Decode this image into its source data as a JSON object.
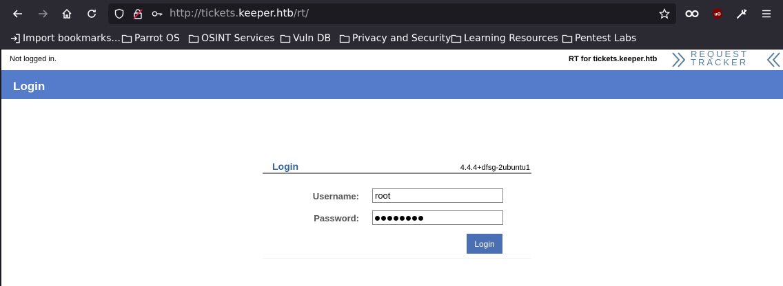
{
  "browser": {
    "url_prefix": "http://tickets.",
    "url_host": "keeper.htb",
    "url_suffix": "/rt/",
    "bookmarks": [
      {
        "label": "Import bookmarks..."
      },
      {
        "label": "Parrot OS"
      },
      {
        "label": "OSINT Services"
      },
      {
        "label": "Vuln DB"
      },
      {
        "label": "Privacy and Security"
      },
      {
        "label": "Learning Resources"
      },
      {
        "label": "Pentest Labs"
      }
    ],
    "addon_badge": "uO"
  },
  "rt": {
    "login_status": "Not logged in.",
    "rt_for": "RT for tickets.keeper.htb",
    "logo_line1": "REQUEST",
    "logo_line2": "TRACKER",
    "page_title": "Login",
    "box_title": "Login",
    "version": "4.4.4+dfsg-2ubuntu1",
    "username_label": "Username:",
    "username_value": "root",
    "password_label": "Password:",
    "password_length": 8,
    "login_button": "Login"
  }
}
